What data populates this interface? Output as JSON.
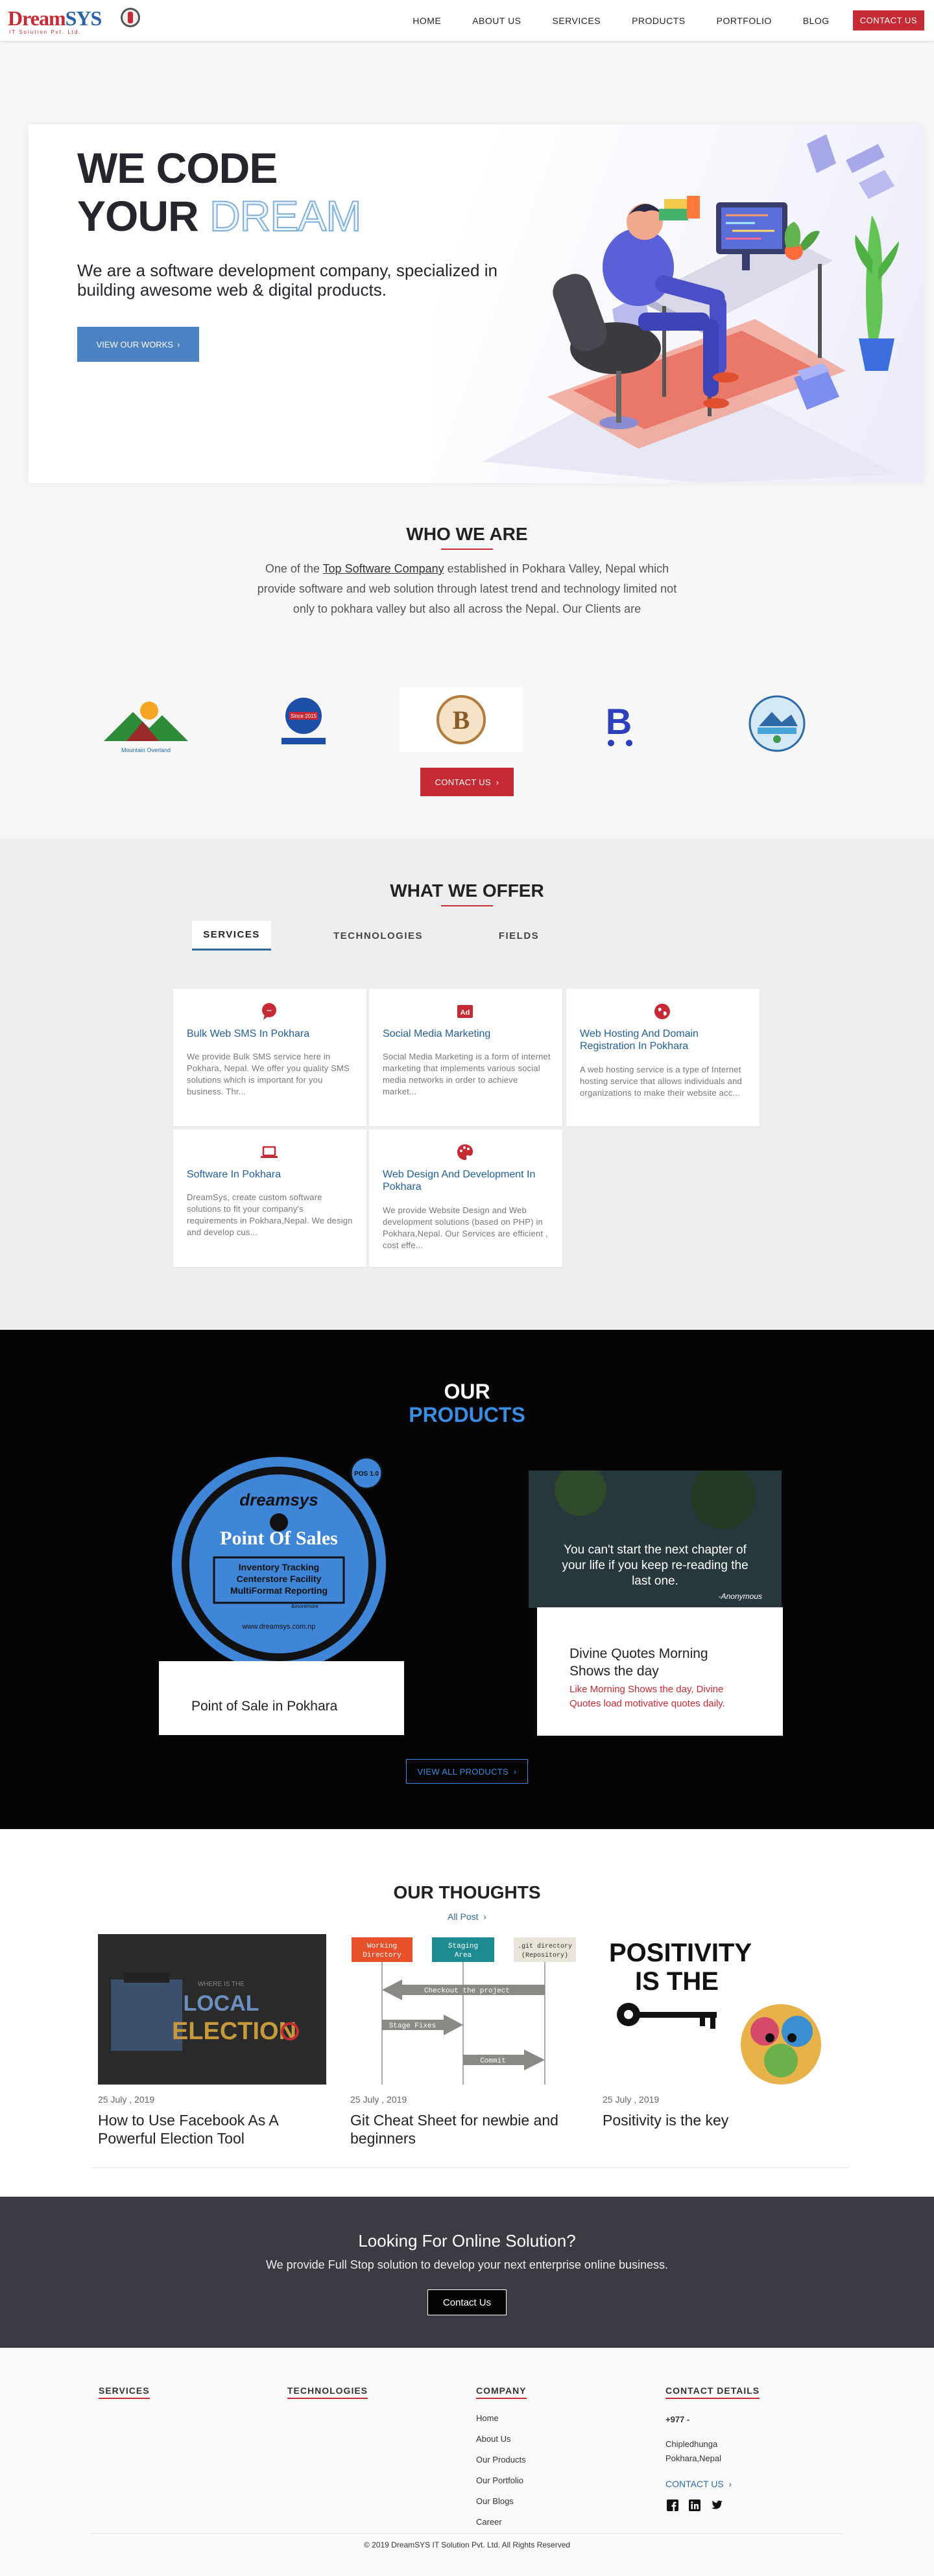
{
  "brand": {
    "logo_dream": "Dream",
    "logo_sys": "SYS",
    "logo_sub": "IT Solution Pvt. Ltd.",
    "colors": {
      "red": "#c62a35",
      "blue": "#2e6aa8",
      "dark": "#3a3b43"
    }
  },
  "nav": {
    "items": [
      "HOME",
      "ABOUT US",
      "SERVICES",
      "PRODUCTS",
      "PORTFOLIO",
      "BLOG"
    ],
    "cta": "CONTACT US"
  },
  "hero": {
    "title_line1": "WE CODE",
    "title_your": "YOUR",
    "title_dream": "DREAM",
    "subtitle": "We are a software development company, specialized in building awesome web & digital products.",
    "button": "VIEW OUR WORKS",
    "button_arrow": "›"
  },
  "who": {
    "title": "WHO WE ARE",
    "text_before": "One of the ",
    "text_link": "Top Software Company",
    "text_after": " established in Pokhara Valley, Nepal which provide software and web solution through latest trend and technology limited not only to pokhara valley but also all across the Nepal. Our Clients are",
    "clients": [
      {
        "name": "Mountain Overland",
        "icon": "mountain-logo"
      },
      {
        "name": "Since 2015",
        "icon": "badge-logo"
      },
      {
        "name": "B",
        "icon": "b-crest-logo"
      },
      {
        "name": "B",
        "icon": "cart-logo"
      },
      {
        "name": "",
        "icon": "lake-seal-logo"
      }
    ],
    "contact_button": "CONTACT US",
    "contact_arrow": "›"
  },
  "offer": {
    "title": "WHAT WE OFFER",
    "tabs": [
      "SERVICES",
      "TECHNOLOGIES",
      "FIELDS"
    ],
    "cards": [
      {
        "title": "Bulk Web SMS In Pokhara",
        "text": "We provide Bulk SMS service here in Pokhara, Nepal. We offer you quality SMS solutions which is important for you business. Thr...",
        "icon": "sms-icon"
      },
      {
        "title": "Social Media Marketing",
        "text": "Social Media Marketing is a form of internet marketing that implements various social media networks in order to achieve market...",
        "icon": "ad-icon"
      },
      {
        "title": "Web Hosting And Domain Registration In Pokhara",
        "text": "A web hosting service is a type of Internet hosting service that allows individuals and organizations to make their website acc...",
        "icon": "globe-icon"
      },
      {
        "title": "Software In Pokhara",
        "text": "DreamSys, create custom software solutions to fit your company's requirements in Pokhara,Nepal. We design and develop cus...",
        "icon": "laptop-icon"
      },
      {
        "title": "Web Design And Development In Pokhara",
        "text": "We provide Website Design and Web development solutions (based on PHP) in Pokhara,Nepal. Our Services are efficient , cost effe...",
        "icon": "palette-icon"
      }
    ]
  },
  "products": {
    "title_our": "OUR",
    "title_products": "PRODUCTS",
    "items": [
      {
        "name": "Point of Sale in Pokhara",
        "image_text": {
          "brand": "dreamsys",
          "heading": "Point Of Sales",
          "features": [
            "Inventory Tracking",
            "Centerstore Facility",
            "MultiFormat Reporting"
          ],
          "more": "&moremore",
          "url": "www.dreamsys.com.np",
          "badge": "POS 1.0"
        }
      },
      {
        "name": "Divine Quotes Morning Shows the day",
        "description": "Like Morning Shows the day, Divine Quotes load motivative quotes daily.",
        "image_text": {
          "quote": "You can't start the next chapter of your life if you keep re-reading the last one.",
          "author": "-Anonymous"
        }
      }
    ],
    "view_all": "VIEW ALL PRODUCTS",
    "view_all_arrow": "›"
  },
  "thoughts": {
    "title": "OUR THOUGHTS",
    "all_post": "All Post",
    "all_post_arrow": "›",
    "posts": [
      {
        "date": "25 July , 2019",
        "title": "How to Use Facebook As A Powerful Election Tool",
        "image_text": {
          "top": "WHERE IS THE",
          "line1": "LOCAL",
          "line2": "ELECTION"
        }
      },
      {
        "date": "25 July , 2019",
        "title": "Git Cheat Sheet for newbie and beginners",
        "image_text": {
          "box1": "Working Directory",
          "box2": "Staging Area",
          "box3": ".git directory (Repository)",
          "arrow1": "Checkout the project",
          "arrow2": "Stage Fixes",
          "arrow3": "Commit"
        }
      },
      {
        "date": "25 July , 2019",
        "title": "Positivity is the key",
        "image_text": {
          "line1": "POSITIVITY",
          "line2": "IS THE"
        }
      }
    ]
  },
  "cta": {
    "title": "Looking For Online Solution?",
    "subtitle": "We provide Full Stop solution to develop your next enterprise online business.",
    "button": "Contact Us"
  },
  "footer": {
    "services_head": "SERVICES",
    "technologies_head": "TECHNOLOGIES",
    "company_head": "COMPANY",
    "company_links": [
      "Home",
      "About Us",
      "Our Products",
      "Our Portfolio",
      "Our Blogs",
      "Career"
    ],
    "contact_head": "CONTACT DETAILS",
    "phone": "+977 -",
    "address_line1": "Chipledhunga",
    "address_line2": "Pokhara,Nepal",
    "contact_link": "CONTACT US",
    "contact_arrow": "›",
    "social": [
      "facebook-icon",
      "linkedin-icon",
      "twitter-icon"
    ],
    "copyright": "© 2019 DreamSYS IT Solution Pvt. Ltd. All Rights Reserved"
  }
}
